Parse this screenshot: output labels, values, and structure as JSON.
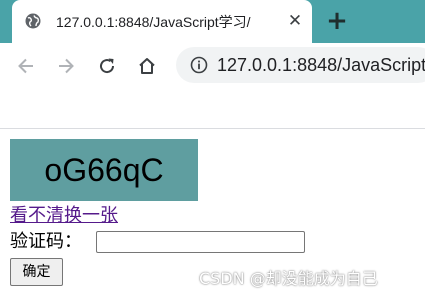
{
  "browser": {
    "tab_title": "127.0.0.1:8848/JavaScript学习/",
    "close_glyph": "✕",
    "new_tab_glyph": "+",
    "address_url": "127.0.0.1:8848/JavaScript",
    "tab_strip_color": "#4aa3a8",
    "icons": [
      "globe-icon",
      "back-arrow-icon",
      "forward-arrow-icon",
      "reload-icon",
      "home-icon",
      "info-icon"
    ]
  },
  "page": {
    "captcha_text": "oG66qC",
    "captcha_bg_color": "#5f9ea0",
    "refresh_link": "看不清换一张",
    "code_label": "验证码：",
    "code_input_value": "",
    "confirm_button": "确定"
  },
  "watermark": "CSDN @却没能成为自己"
}
